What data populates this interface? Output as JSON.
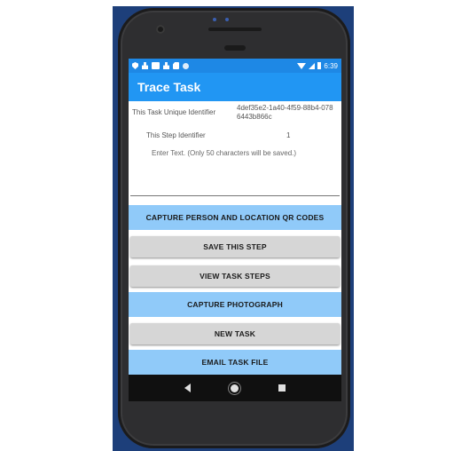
{
  "colors": {
    "statusbar": "#1e88e5",
    "appbar": "#2196f3",
    "blue_button": "#90caf9",
    "gray_button": "#d6d6d6"
  },
  "statusbar": {
    "icons": [
      "shield-icon",
      "person-icon",
      "photo-icon",
      "person-icon",
      "sd-card-icon",
      "circle-icon"
    ],
    "time": "6:39"
  },
  "appbar": {
    "title": "Trace Task"
  },
  "task": {
    "uid_label": "This Task Unique Identifier",
    "uid_value": "4def35e2-1a40-4f59-88b4-0786443b866c",
    "step_label": "This Step Identifier",
    "step_value": "1",
    "text_placeholder": "Enter Text. (Only 50 characters will be saved.)"
  },
  "buttons": {
    "capture_qr": "CAPTURE PERSON AND LOCATION QR CODES",
    "save_step": "SAVE THIS STEP",
    "view_steps": "VIEW TASK STEPS",
    "capture_photo": "CAPTURE PHOTOGRAPH",
    "new_task": "NEW TASK",
    "email_file": "EMAIL TASK FILE"
  }
}
